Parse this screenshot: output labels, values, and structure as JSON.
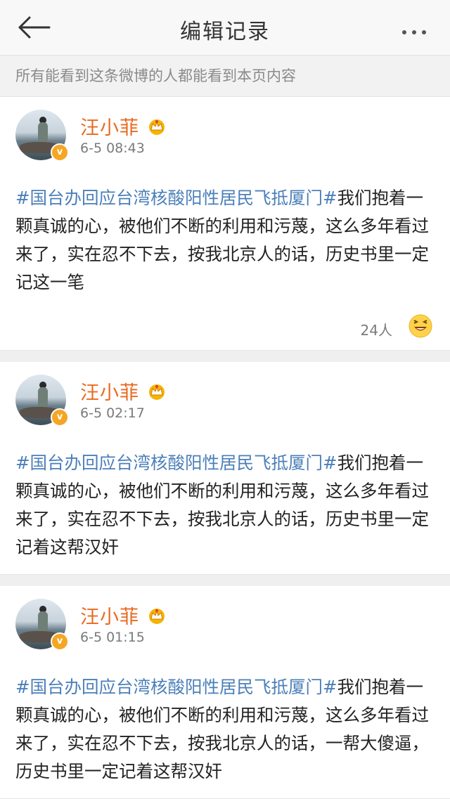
{
  "header": {
    "title": "编辑记录"
  },
  "notice": "所有能看到这条微博的人都能看到本页内容",
  "posts": [
    {
      "author": "汪小菲",
      "time": "6-5 08:43",
      "tag": "#国台办回应台湾核酸阳性居民飞抵厦门#",
      "body": "我们抱着一颗真诚的心，被他们不断的利用和污蔑，这么多年看过来了，实在忍不下去，按我北京人的话，历史书里一定记这一笔",
      "likes": "24人"
    },
    {
      "author": "汪小菲",
      "time": "6-5 02:17",
      "tag": "#国台办回应台湾核酸阳性居民飞抵厦门#",
      "body": "我们抱着一颗真诚的心，被他们不断的利用和污蔑，这么多年看过来了，实在忍不下去，按我北京人的话，历史书里一定记着这帮汉奸"
    },
    {
      "author": "汪小菲",
      "time": "6-5 01:15",
      "tag": "#国台办回应台湾核酸阳性居民飞抵厦门#",
      "body": "我们抱着一颗真诚的心，被他们不断的利用和污蔑，这么多年看过来了，实在忍不下去，按我北京人的话，一帮大傻逼，历史书里一定记着这帮汉奸"
    }
  ],
  "colors": {
    "accent_name": "#e86a20",
    "topic_link": "#4b7fb9",
    "verified_badge": "#f5a623"
  },
  "icons": {
    "back": "arrow-left-icon",
    "more": "more-dots-icon",
    "vip": "crown-icon",
    "like": "laughing-emoji-icon",
    "verified": "verified-badge-icon"
  }
}
